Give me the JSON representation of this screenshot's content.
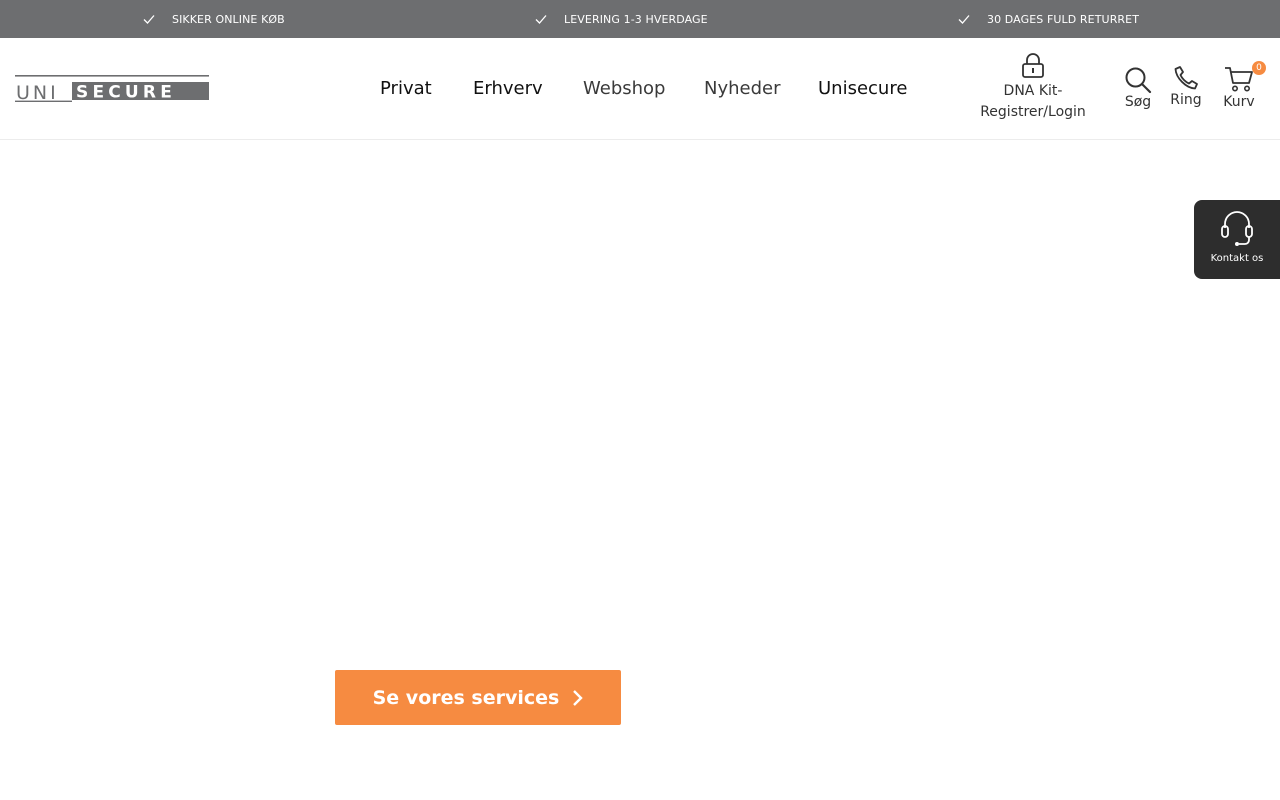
{
  "topbar": {
    "usps": [
      {
        "label": "SIKKER ONLINE KØB",
        "icon": "check-icon"
      },
      {
        "label": "LEVERING 1-3 HVERDAGE",
        "icon": "check-icon"
      },
      {
        "label": "30 DAGES FULD RETURRET",
        "icon": "check-icon"
      }
    ]
  },
  "header": {
    "logo_text": "UNISECURE",
    "nav": [
      "Privat",
      "Erhverv",
      "Webshop",
      "Nyheder",
      "Unisecure"
    ],
    "dna_login": {
      "line1": "DNA Kit-",
      "line2": "Registrer/Login",
      "icon": "lock-icon"
    },
    "search_label": "Søg",
    "phone_label": "Ring",
    "cart_label": "Kurv",
    "cart_count": "0"
  },
  "contact_widget": {
    "label": "Kontakt os",
    "icon": "headset-icon"
  },
  "hero": {
    "cta_label": "Se vores services"
  },
  "colors": {
    "topbar_bg": "#6d6e70",
    "accent": "#f68b41",
    "contact_bg": "#2d2d2d",
    "text": "#1c1c1c"
  }
}
